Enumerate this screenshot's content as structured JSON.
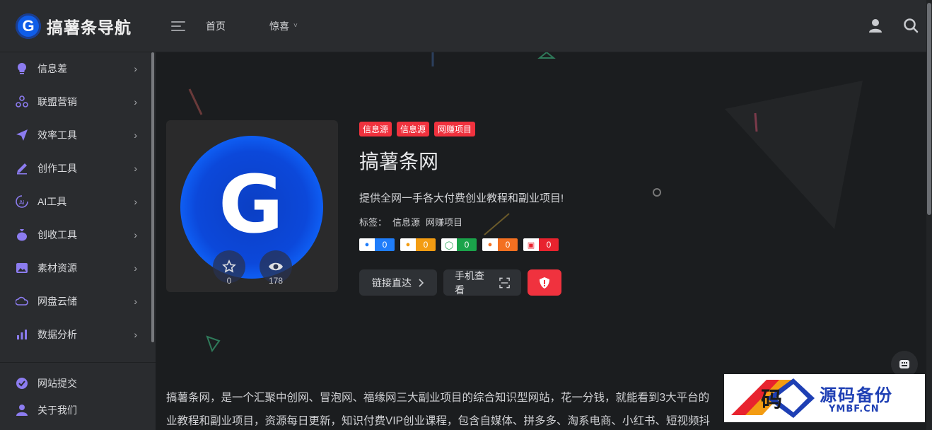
{
  "header": {
    "logo_letter": "G",
    "logo_text": "搞薯条导航",
    "nav_home": "首页",
    "nav_surprise": "惊喜",
    "chevron": "˅",
    "icons": [
      "user-icon",
      "search-icon"
    ]
  },
  "sidebar": {
    "items": [
      {
        "label": "信息差",
        "icon": "lightbulb-icon"
      },
      {
        "label": "联盟营销",
        "icon": "network-icon"
      },
      {
        "label": "效率工具",
        "icon": "send-icon"
      },
      {
        "label": "创作工具",
        "icon": "pen-icon"
      },
      {
        "label": "AI工具",
        "icon": "ai-icon"
      },
      {
        "label": "创收工具",
        "icon": "moneybag-icon"
      },
      {
        "label": "素材资源",
        "icon": "image-icon"
      },
      {
        "label": "网盘云储",
        "icon": "cloud-icon"
      },
      {
        "label": "数据分析",
        "icon": "chart-icon"
      }
    ],
    "bottom": [
      {
        "label": "网站提交",
        "icon": "check-circle-icon"
      },
      {
        "label": "关于我们",
        "icon": "person-icon"
      }
    ],
    "arrow": "›"
  },
  "site": {
    "tags": [
      "信息源",
      "信息源",
      "网赚项目"
    ],
    "title": "搞薯条网",
    "description": "提供全网一手各大付费创业教程和副业项目!",
    "labels_prefix": "标签：",
    "labels": [
      "信息源",
      "网赚项目"
    ],
    "favorites": "0",
    "views": "178",
    "counters": [
      {
        "icon": "baidu-icon",
        "value": "0",
        "color": "#1f7dfa"
      },
      {
        "icon": "baidu-mobile-icon",
        "value": "0",
        "color": "#f39c12"
      },
      {
        "icon": "360-icon",
        "value": "0",
        "color": "#1aa34a"
      },
      {
        "icon": "sogou-icon",
        "value": "0",
        "color": "#f37021"
      },
      {
        "icon": "toutiao-icon",
        "value": "0",
        "color": "#e8232e"
      }
    ],
    "btn_visit": "链接直达",
    "btn_mobile": "手机查看",
    "btn_report_icon": "shield-icon"
  },
  "article": {
    "line1": "搞薯条网，是一个汇聚中创网、冒泡网、福缘网三大副业项目的综合知识型网站，花一分钱，就能看到3大平台的",
    "line2": "业教程和副业项目，资源每日更新，知识付费VIP创业课程，包含自媒体、拼多多、淘系电商、小红书、短视频抖"
  },
  "watermark": {
    "title": "源码备份",
    "url": "YMBF.CN",
    "glyph": "码"
  },
  "colors": {
    "accent": "#f0323e",
    "brand": "#0f5de8",
    "sidebar_icon": "#8c7cf0"
  }
}
